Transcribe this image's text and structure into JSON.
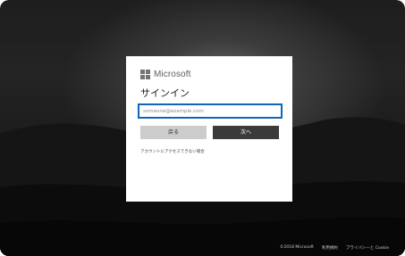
{
  "brand": {
    "name": "Microsoft",
    "logo_color": "#737373"
  },
  "signin": {
    "title": "サインイン",
    "email_placeholder": "someone@example.com",
    "email_value": "",
    "back_label": "戻る",
    "next_label": "次へ",
    "cant_access_link": "アカウントにアクセスできない場合"
  },
  "footer": {
    "copyright": "©2018 Microsoft",
    "terms": "利用規約",
    "privacy": "プライバシーと Cookie"
  },
  "colors": {
    "accent_border": "#0f65b6",
    "next_button": "#3b3b3b",
    "back_button": "#cccccc",
    "card": "#ffffff"
  }
}
